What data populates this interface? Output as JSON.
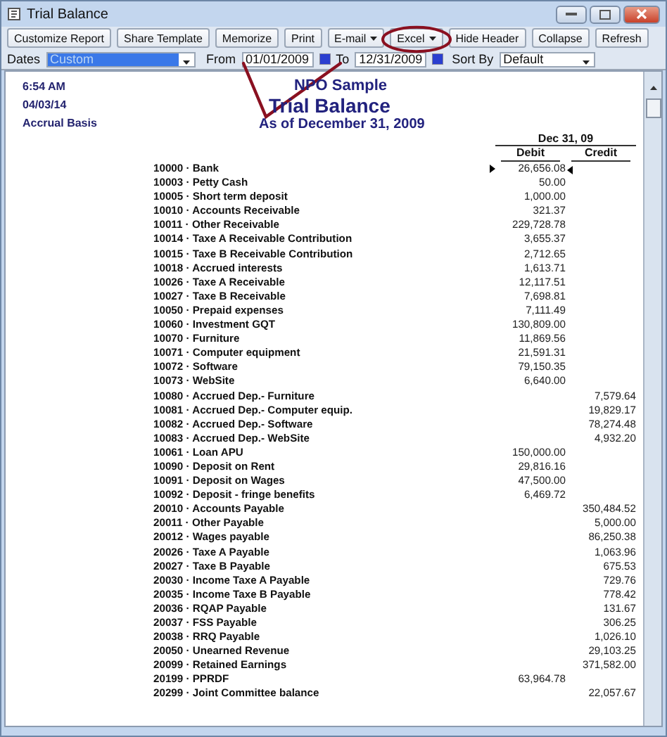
{
  "window": {
    "title": "Trial Balance"
  },
  "toolbar": [
    {
      "label": "Customize Report",
      "kind": "plain"
    },
    {
      "label": "Share Template",
      "kind": "plain"
    },
    {
      "label": "Memorize",
      "kind": "plain"
    },
    {
      "label": "Print",
      "kind": "plain"
    },
    {
      "label": "E-mail",
      "kind": "dropdown"
    },
    {
      "label": "Excel",
      "kind": "dropdown"
    },
    {
      "label": "Hide Header",
      "kind": "plain"
    },
    {
      "label": "Collapse",
      "kind": "plain"
    },
    {
      "label": "Refresh",
      "kind": "plain"
    }
  ],
  "filters": {
    "dates_label": "Dates",
    "dates_value": "Custom",
    "from_label": "From",
    "from_value": "01/01/2009",
    "to_label": "To",
    "to_value": "12/31/2009",
    "sort_label": "Sort By",
    "sort_value": "Default"
  },
  "report": {
    "time": "6:54 AM",
    "date": "04/03/14",
    "basis": "Accrual Basis",
    "company": "NPO Sample",
    "title": "Trial Balance",
    "subtitle": "As of December 31, 2009",
    "period": "Dec 31, 09",
    "columns": [
      "Debit",
      "Credit"
    ],
    "rows": [
      {
        "account": "10000 · Bank",
        "debit": "26,656.08",
        "selected": true
      },
      {
        "account": "10003 · Petty Cash",
        "debit": "50.00",
        "selected": false
      },
      {
        "account": "10005 · Short term deposit",
        "debit": "1,000.00",
        "selected": false
      },
      {
        "account": "10010 · Accounts Receivable",
        "debit": "321.37",
        "selected": false
      },
      {
        "account": "10011 · Other Receivable",
        "debit": "229,728.78",
        "selected": false
      },
      {
        "account": "10014 · Taxe A Receivable Contribution",
        "debit": "3,655.37",
        "selected": false
      },
      {
        "account": "10015 · Taxe B Receivable Contribution",
        "debit": "2,712.65",
        "selected": false
      },
      {
        "account": "10018 · Accrued interests",
        "debit": "1,613.71",
        "selected": false
      },
      {
        "account": "10026 · Taxe A Receivable",
        "debit": "12,117.51",
        "selected": false
      },
      {
        "account": "10027 · Taxe B Receivable",
        "debit": "7,698.81",
        "selected": false
      },
      {
        "account": "10050 · Prepaid expenses",
        "debit": "7,111.49",
        "selected": false
      },
      {
        "account": "10060 · Investment GQT",
        "debit": "130,809.00",
        "selected": false
      },
      {
        "account": "10070 · Furniture",
        "debit": "11,869.56",
        "selected": false
      },
      {
        "account": "10071 · Computer equipment",
        "debit": "21,591.31",
        "selected": false
      },
      {
        "account": "10072 · Software",
        "debit": "79,150.35",
        "selected": false
      },
      {
        "account": "10073 · WebSite",
        "debit": "6,640.00",
        "selected": false
      },
      {
        "account": "10080 · Accrued Dep.- Furniture",
        "credit": "7,579.64",
        "selected": false
      },
      {
        "account": "10081 · Accrued Dep.- Computer equip.",
        "credit": "19,829.17",
        "selected": false
      },
      {
        "account": "10082 · Accrued Dep.- Software",
        "credit": "78,274.48",
        "selected": false
      },
      {
        "account": "10083 · Accrued Dep.- WebSite",
        "credit": "4,932.20",
        "selected": false
      },
      {
        "account": "10061 · Loan APU",
        "debit": "150,000.00",
        "selected": false
      },
      {
        "account": "10090 · Deposit on Rent",
        "debit": "29,816.16",
        "selected": false
      },
      {
        "account": "10091 · Deposit on Wages",
        "debit": "47,500.00",
        "selected": false
      },
      {
        "account": "10092 · Deposit - fringe benefits",
        "debit": "6,469.72",
        "selected": false
      },
      {
        "account": "20010 · Accounts Payable",
        "credit": "350,484.52",
        "selected": false
      },
      {
        "account": "20011 · Other Payable",
        "credit": "5,000.00",
        "selected": false
      },
      {
        "account": "20012 · Wages payable",
        "credit": "86,250.38",
        "selected": false
      },
      {
        "account": "20026 · Taxe A Payable",
        "credit": "1,063.96",
        "selected": false
      },
      {
        "account": "20027 · Taxe B Payable",
        "credit": "675.53",
        "selected": false
      },
      {
        "account": "20030 · Income Taxe A Payable",
        "credit": "729.76",
        "selected": false
      },
      {
        "account": "20035 · Income Taxe B Payable",
        "credit": "778.42",
        "selected": false
      },
      {
        "account": "20036 · RQAP Payable",
        "credit": "131.67",
        "selected": false
      },
      {
        "account": "20037 · FSS Payable",
        "credit": "306.25",
        "selected": false
      },
      {
        "account": "20038 · RRQ Payable",
        "credit": "1,026.10",
        "selected": false
      },
      {
        "account": "20050 · Unearned Revenue",
        "credit": "29,103.25",
        "selected": false
      },
      {
        "account": "20099 · Retained Earnings",
        "credit": "371,582.00",
        "selected": false
      },
      {
        "account": "20199 · PPRDF",
        "debit": "63,964.78",
        "selected": false
      },
      {
        "account": "20299 · Joint Committee balance",
        "credit": "22,057.67",
        "selected": false
      }
    ]
  }
}
